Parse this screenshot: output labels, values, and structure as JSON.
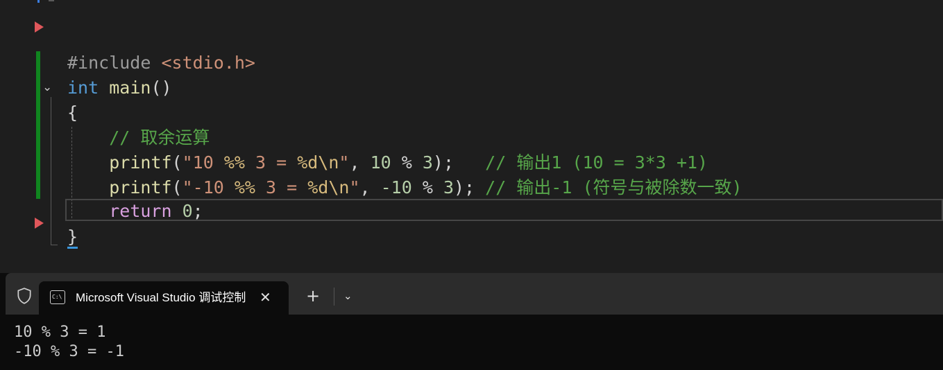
{
  "editor": {
    "lines": [
      {
        "tokens": [
          {
            "t": "#include ",
            "c": "pp"
          },
          {
            "t": "<stdio.h>",
            "c": "str"
          }
        ]
      },
      {
        "tokens": [
          {
            "t": "int",
            "c": "kw"
          },
          {
            "t": " ",
            "c": "pl"
          },
          {
            "t": "main",
            "c": "fn"
          },
          {
            "t": "()",
            "c": "pl"
          }
        ]
      },
      {
        "tokens": [
          {
            "t": "{",
            "c": "pl"
          }
        ]
      },
      {
        "tokens": [
          {
            "t": "    // 取余运算",
            "c": "cmt"
          }
        ]
      },
      {
        "tokens": [
          {
            "t": "    ",
            "c": "pl"
          },
          {
            "t": "printf",
            "c": "fn"
          },
          {
            "t": "(",
            "c": "pl"
          },
          {
            "t": "\"10 ",
            "c": "str"
          },
          {
            "t": "%%",
            "c": "fmt"
          },
          {
            "t": " 3 = ",
            "c": "str"
          },
          {
            "t": "%d\\n",
            "c": "fmt"
          },
          {
            "t": "\"",
            "c": "str"
          },
          {
            "t": ", ",
            "c": "pl"
          },
          {
            "t": "10",
            "c": "num"
          },
          {
            "t": " % ",
            "c": "pl"
          },
          {
            "t": "3",
            "c": "num"
          },
          {
            "t": ");   ",
            "c": "pl"
          },
          {
            "t": "// 输出1 (10 = 3*3 +1)",
            "c": "cmt"
          }
        ]
      },
      {
        "tokens": [
          {
            "t": "    ",
            "c": "pl"
          },
          {
            "t": "printf",
            "c": "fn"
          },
          {
            "t": "(",
            "c": "pl"
          },
          {
            "t": "\"-10 ",
            "c": "str"
          },
          {
            "t": "%%",
            "c": "fmt"
          },
          {
            "t": " 3 = ",
            "c": "str"
          },
          {
            "t": "%d\\n",
            "c": "fmt"
          },
          {
            "t": "\"",
            "c": "str"
          },
          {
            "t": ", ",
            "c": "pl"
          },
          {
            "t": "-10",
            "c": "num"
          },
          {
            "t": " % ",
            "c": "pl"
          },
          {
            "t": "3",
            "c": "num"
          },
          {
            "t": "); ",
            "c": "pl"
          },
          {
            "t": "// 输出-1 (符号与被除数一致)",
            "c": "cmt"
          }
        ]
      },
      {
        "tokens": [
          {
            "t": "    ",
            "c": "pl"
          },
          {
            "t": "return",
            "c": "ret"
          },
          {
            "t": " ",
            "c": "pl"
          },
          {
            "t": "0",
            "c": "num"
          },
          {
            "t": ";",
            "c": "pl"
          }
        ]
      },
      {
        "tokens": [
          {
            "t": "}",
            "c": "pl"
          }
        ]
      }
    ]
  },
  "terminal": {
    "tab_title": "Microsoft Visual Studio 调试控制台",
    "tab_icon_text": "C:\\",
    "close_glyph": "✕",
    "new_tab_glyph": "+",
    "dropdown_glyph": "⌄",
    "output": [
      "10 % 3 = 1",
      "-10 % 3 = -1"
    ]
  },
  "icons": {
    "fold": "chevron-down-icon",
    "shield": "shield-icon",
    "breakpoint": "breakpoint-arrow-icon"
  }
}
